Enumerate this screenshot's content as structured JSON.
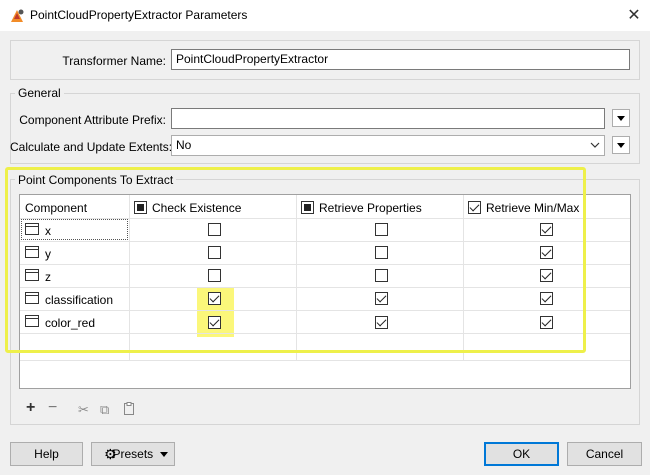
{
  "window": {
    "title": "PointCloudPropertyExtractor Parameters",
    "close_glyph": "✕"
  },
  "transformer": {
    "label": "Transformer Name:",
    "value": "PointCloudPropertyExtractor"
  },
  "general": {
    "title": "General",
    "prefix_label": "Component Attribute Prefix:",
    "prefix_value": "",
    "extents_label": "Calculate and Update Extents:",
    "extents_value": "No"
  },
  "components": {
    "title": "Point Components To Extract",
    "columns": {
      "component": "Component",
      "check_existence": "Check Existence",
      "retrieve_properties": "Retrieve Properties",
      "retrieve_minmax": "Retrieve Min/Max"
    },
    "header_states": {
      "check_existence": "mixed",
      "retrieve_properties": "mixed",
      "retrieve_minmax": "checked"
    },
    "rows": [
      {
        "name": "x",
        "check_existence": false,
        "retrieve_properties": false,
        "retrieve_minmax": true
      },
      {
        "name": "y",
        "check_existence": false,
        "retrieve_properties": false,
        "retrieve_minmax": true
      },
      {
        "name": "z",
        "check_existence": false,
        "retrieve_properties": false,
        "retrieve_minmax": true
      },
      {
        "name": "classification",
        "check_existence": true,
        "retrieve_properties": true,
        "retrieve_minmax": true
      },
      {
        "name": "color_red",
        "check_existence": true,
        "retrieve_properties": true,
        "retrieve_minmax": true
      }
    ]
  },
  "toolbar": {
    "add_glyph": "+",
    "remove_glyph": "−",
    "cut_glyph": "✂",
    "copy_glyph": "⧉",
    "paste_glyph": "📋"
  },
  "buttons": {
    "help": "Help",
    "presets": "Presets",
    "ok": "OK",
    "cancel": "Cancel"
  },
  "colors": {
    "highlight_frame": "#eef04a",
    "highlight_fill": "#fbf77a",
    "default_button_border": "#0078d7"
  }
}
